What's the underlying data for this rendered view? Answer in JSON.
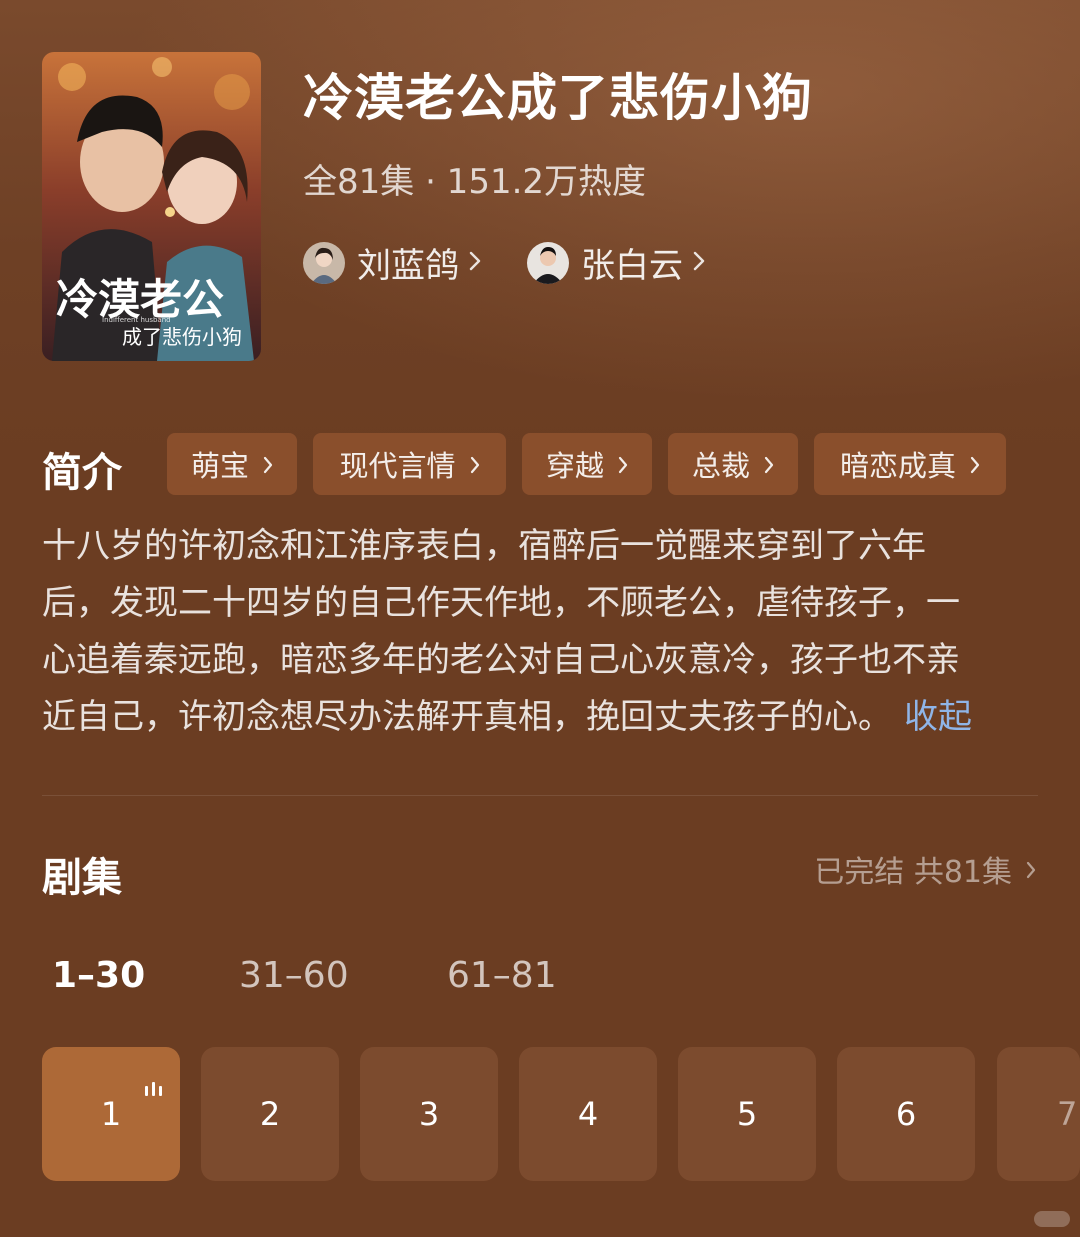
{
  "drama": {
    "title": "冷漠老公成了悲伤小狗",
    "meta": "全81集 · 151.2万热度",
    "poster_title_line1": "冷漠老公",
    "poster_title_line2": "成了悲伤小狗",
    "poster_subtitle": "Indifferent husband"
  },
  "cast": [
    {
      "name": "刘蓝鸽"
    },
    {
      "name": "张白云"
    }
  ],
  "intro": {
    "heading": "简介",
    "tags": [
      "萌宝",
      "现代言情",
      "穿越",
      "总裁",
      "暗恋成真"
    ],
    "synopsis_lines": [
      "十八岁的许初念和江淮序表白，宿醉后一觉醒来穿到了六年",
      "后，发现二十四岁的自己作天作地，不顾老公，虐待孩子，一",
      "心追着秦远跑，暗恋多年的老公对自己心灰意冷，孩子也不亲",
      "近自己，许初念想尽办法解开真相，挽回丈夫孩子的心。"
    ],
    "collapse_label": "收起"
  },
  "episodes": {
    "heading": "剧集",
    "status": "已完结 共81集",
    "ranges": [
      "1–30",
      "31–60",
      "61–81"
    ],
    "active_range": "1–30",
    "tiles": [
      "1",
      "2",
      "3",
      "4",
      "5",
      "6",
      "7"
    ],
    "current_episode": "1"
  },
  "colors": {
    "background": "#6b3d22",
    "tag_bg": "#8a4f2c",
    "tile_bg": "#7c4b2e",
    "tile_active_bg": "#ad6937",
    "link": "#8fb5e8"
  }
}
